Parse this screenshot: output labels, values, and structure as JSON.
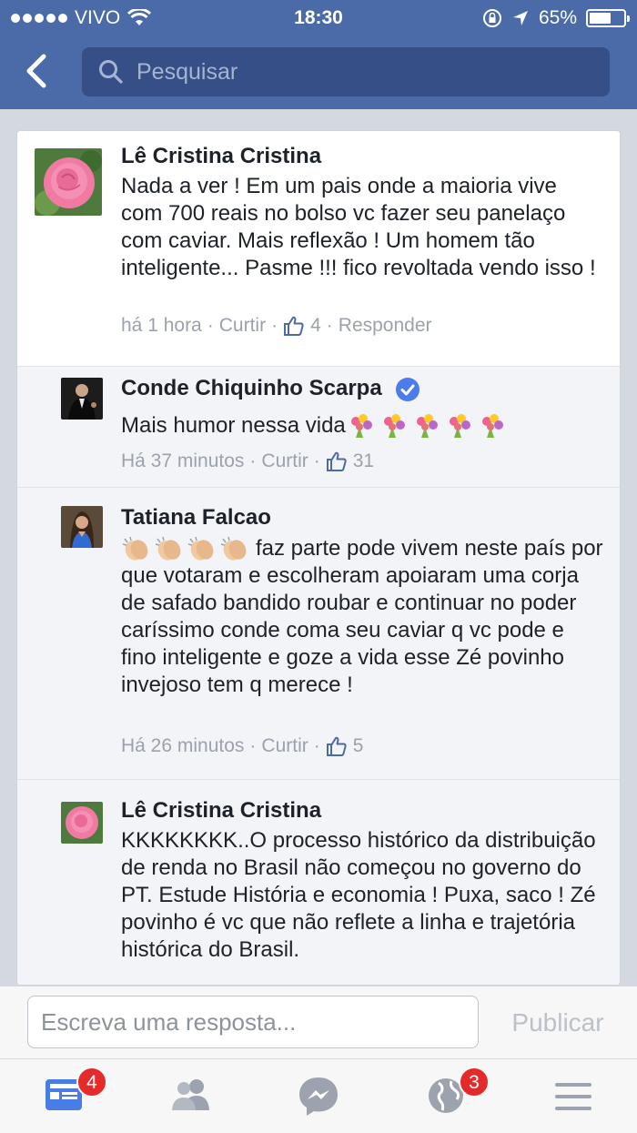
{
  "status_bar": {
    "carrier": "VIVO",
    "time": "18:30",
    "battery": "65%",
    "battery_level": 0.65
  },
  "nav": {
    "back_icon": "chevron-left-icon",
    "search_placeholder": "Pesquisar"
  },
  "comments": [
    {
      "author": "Lê Cristina Cristina",
      "avatar": "pink-rose-photo",
      "text": "Nada a ver ! Em um pais onde a maioria vive com 700 reais no bolso vc  fazer seu panelaço com caviar.  Mais reflexão ! Um homem tão inteligente... Pasme !!! fico revoltada vendo isso !",
      "time": "há 1 hora",
      "like_label": "Curtir",
      "likes": "4",
      "reply_label": "Responder"
    },
    {
      "author": "Conde Chiquinho Scarpa",
      "verified": true,
      "avatar": "man-in-suit-photo",
      "text": "Mais humor nessa vida",
      "emoji": "bouquet",
      "emoji_count": 5,
      "time": "Há 37 minutos",
      "like_label": "Curtir",
      "likes": "31"
    },
    {
      "author": "Tatiana Falcao",
      "avatar": "woman-photo",
      "emoji": "clapping-hands",
      "emoji_count": 4,
      "text": "faz parte pode vivem neste país por que votaram e escolheram apoiaram uma corja de safado bandido roubar e continuar no poder caríssimo conde coma seu caviar q vc pode e fino inteligente e goze a vida esse Zé povinho invejoso tem q merece !",
      "time": "Há 26 minutos",
      "like_label": "Curtir",
      "likes": "5"
    },
    {
      "author": "Lê Cristina Cristina",
      "avatar": "pink-rose-photo",
      "text": "KKKKKKKK..O processo histórico da distribuição de renda no Brasil  não começou no governo do PT. Estude  História e economia ! Puxa, saco !  Zé povinho é vc que não reflete a linha e trajetória histórica do Brasil."
    }
  ],
  "composer": {
    "placeholder": "Escreva uma resposta...",
    "publish_label": "Publicar"
  },
  "tab_bar": [
    {
      "icon": "news-feed-icon",
      "badge": "4",
      "active": true
    },
    {
      "icon": "friends-icon"
    },
    {
      "icon": "messenger-icon"
    },
    {
      "icon": "notifications-globe-icon",
      "badge": "3"
    },
    {
      "icon": "menu-icon"
    }
  ],
  "colors": {
    "brand": "#4b6aa8",
    "active_tab": "#4a7ce6",
    "badge": "#e42a2a",
    "verified": "#4b7bec"
  }
}
